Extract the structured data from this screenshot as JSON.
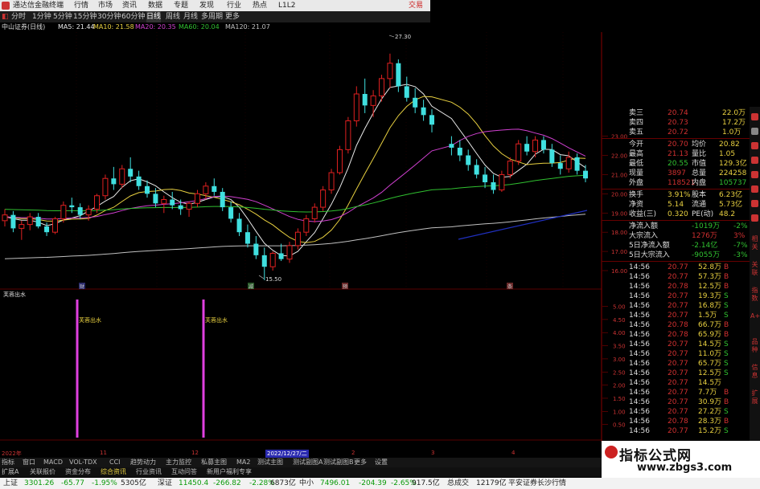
{
  "window": {
    "title": "通达信金融终端",
    "menus": [
      "行情",
      "市场",
      "资讯",
      "数据",
      "专题",
      "发现",
      "行业",
      "热点",
      "L1L2"
    ],
    "trade_label": "交易"
  },
  "period_tabs": [
    "分时",
    "1分钟",
    "5分钟",
    "15分钟",
    "30分钟",
    "60分钟",
    "日线",
    "周线",
    "月线",
    "多周期",
    "更多"
  ],
  "active_period": "日线",
  "indicators": {
    "stock": "中山证券(日线)",
    "ma5": "MA5: 21.44",
    "ma10": "MA10: 21.58",
    "ma20": "MA20: 20.35",
    "ma60": "MA60: 20.04",
    "ma120": "MA120: 21.07",
    "colors": {
      "ma5": "#e8e8e8",
      "ma10": "#e8d040",
      "ma20": "#d040d0",
      "ma60": "#30c030",
      "ma120": "#c0c0c0",
      "up": "#e02020",
      "down": "#40e0e0"
    }
  },
  "chart_annotations": {
    "high": "27.30",
    "low": "15.50"
  },
  "price_axis": [
    "23.00",
    "22.00",
    "21.00",
    "20.00",
    "19.00",
    "18.00",
    "17.00",
    "16.00"
  ],
  "sub_indicator": {
    "name": "芙蓉出水",
    "signal_label": "芙蓉出水",
    "axis": [
      "5.00",
      "4.50",
      "4.00",
      "3.50",
      "3.00",
      "2.50",
      "2.00",
      "1.50",
      "1.00",
      "0.50"
    ]
  },
  "event_markers": [
    "财",
    "减",
    "预",
    "条"
  ],
  "x_axis": {
    "start": "2022年",
    "m11": "11",
    "m12": "12",
    "cursor_date": "2022/12/27/二",
    "m2": "2",
    "m3": "3",
    "m4": "4"
  },
  "quote": {
    "order_book": [
      {
        "label": "卖三",
        "price": "20.74",
        "vol": "22.0万"
      },
      {
        "label": "卖四",
        "price": "20.73",
        "vol": "17.2万"
      },
      {
        "label": "卖五",
        "price": "20.72",
        "vol": "1.0万"
      }
    ],
    "stats": [
      {
        "l1": "今开",
        "v1": "20.70",
        "l2": "均价",
        "v2": "20.82"
      },
      {
        "l1": "最高",
        "v1": "21.13",
        "l2": "量比",
        "v2": "1.05"
      },
      {
        "l1": "最低",
        "v1": "20.55",
        "l2": "市值",
        "v2": "129.3亿"
      },
      {
        "l1": "现量",
        "v1": "3897",
        "l2": "总量",
        "v2": "224258"
      },
      {
        "l1": "外盘",
        "v1": "118521",
        "l2": "内盘",
        "v2": "105737"
      }
    ],
    "stats2": [
      {
        "l1": "换手",
        "v1": "3.91%",
        "l2": "股本",
        "v2": "6.23亿"
      },
      {
        "l1": "净资",
        "v1": "5.14",
        "l2": "流通",
        "v2": "5.73亿"
      },
      {
        "l1": "收益(三)",
        "v1": "0.320",
        "l2": "PE(动)",
        "v2": "48.2"
      }
    ],
    "flows": [
      {
        "label": "净流入额",
        "value": "-1019万",
        "pct": "-2%"
      },
      {
        "label": "大宗流入",
        "value": "1276万",
        "pct": "3%"
      },
      {
        "label": "5日净流入额",
        "value": "-2.14亿",
        "pct": "-7%"
      },
      {
        "label": "5日大宗流入",
        "value": "-9055万",
        "pct": "-3%"
      }
    ],
    "ticks": [
      {
        "t": "14:56",
        "p": "20.77",
        "v": "52.8万",
        "s": "B"
      },
      {
        "t": "14:56",
        "p": "20.77",
        "v": "57.3万",
        "s": "B"
      },
      {
        "t": "14:56",
        "p": "20.78",
        "v": "12.5万",
        "s": "B"
      },
      {
        "t": "14:56",
        "p": "20.77",
        "v": "19.3万",
        "s": "S"
      },
      {
        "t": "14:56",
        "p": "20.77",
        "v": "16.8万",
        "s": "S"
      },
      {
        "t": "14:56",
        "p": "20.77",
        "v": "1.5万",
        "s": "S"
      },
      {
        "t": "14:56",
        "p": "20.78",
        "v": "66.7万",
        "s": "B"
      },
      {
        "t": "14:56",
        "p": "20.78",
        "v": "65.9万",
        "s": "B"
      },
      {
        "t": "14:56",
        "p": "20.77",
        "v": "14.5万",
        "s": "S"
      },
      {
        "t": "14:56",
        "p": "20.77",
        "v": "11.0万",
        "s": "S"
      },
      {
        "t": "14:56",
        "p": "20.77",
        "v": "65.7万",
        "s": "S"
      },
      {
        "t": "14:56",
        "p": "20.77",
        "v": "12.5万",
        "s": "S"
      },
      {
        "t": "14:56",
        "p": "20.77",
        "v": "14.5万",
        "s": ""
      },
      {
        "t": "14:56",
        "p": "20.77",
        "v": "7.7万",
        "s": "B"
      },
      {
        "t": "14:56",
        "p": "20.77",
        "v": "30.9万",
        "s": "B"
      },
      {
        "t": "14:56",
        "p": "20.77",
        "v": "27.2万",
        "s": "S"
      },
      {
        "t": "14:56",
        "p": "20.78",
        "v": "28.3万",
        "s": "B"
      },
      {
        "t": "14:56",
        "p": "20.77",
        "v": "15.2万",
        "s": "S"
      }
    ]
  },
  "tabs_row1": [
    "指标",
    "窗口",
    "MACD",
    "VOL-TDX",
    "CCI",
    "趋势动力",
    "主力监控",
    "私募主图",
    "MA2",
    "测试主图",
    "测试副图A",
    "测试副图B",
    "更多",
    "设置"
  ],
  "tabs_row2": [
    "扩展A",
    "关联报价",
    "资金分布",
    "综合资讯",
    "行业资讯",
    "互动问答",
    "新用户福利专享"
  ],
  "status": {
    "sh_name": "上证",
    "sh_val": "3301.26",
    "sh_chg": "-65.77",
    "sh_pct": "-1.95%",
    "sh_amt": "5305亿",
    "sz_name": "深证",
    "sz_val": "11450.4",
    "sz_chg": "-266.82",
    "sz_pct": "-2.28%",
    "sz_amt": "6873亿",
    "zx_name": "中小",
    "zx_val": "7496.01",
    "zx_chg": "-204.39",
    "zx_pct": "-2.65%",
    "zx_amt": "917.5亿",
    "total_label": "总成交",
    "total_val": "12179亿",
    "broker": "平安证券长沙行情"
  },
  "watermark": {
    "line1": "指标公式网",
    "line2": "www.zbgs3.com"
  },
  "sidebar_text": [
    "相关",
    "关联",
    "指数",
    "A+H",
    "品种",
    "信息",
    "扩展"
  ],
  "chart_data": {
    "type": "candlestick",
    "ohlc": [
      [
        18.6,
        19.2,
        18.3,
        18.9
      ],
      [
        18.9,
        19.1,
        18.0,
        18.2
      ],
      [
        18.2,
        18.6,
        17.6,
        18.4
      ],
      [
        18.4,
        19.0,
        18.1,
        18.8
      ],
      [
        18.8,
        19.0,
        18.2,
        18.3
      ],
      [
        18.3,
        18.5,
        17.8,
        18.0
      ],
      [
        18.0,
        18.8,
        17.9,
        18.7
      ],
      [
        18.7,
        19.6,
        18.5,
        19.4
      ],
      [
        19.4,
        19.8,
        19.0,
        19.3
      ],
      [
        19.3,
        19.5,
        18.7,
        18.9
      ],
      [
        18.9,
        19.4,
        18.6,
        19.2
      ],
      [
        19.2,
        20.0,
        19.0,
        19.9
      ],
      [
        19.9,
        21.0,
        19.7,
        20.8
      ],
      [
        20.8,
        21.4,
        20.2,
        20.5
      ],
      [
        20.5,
        21.5,
        20.3,
        21.3
      ],
      [
        21.3,
        21.9,
        20.6,
        20.9
      ],
      [
        20.9,
        21.2,
        20.2,
        20.4
      ],
      [
        20.4,
        20.7,
        19.8,
        20.0
      ],
      [
        20.0,
        20.3,
        19.3,
        19.5
      ],
      [
        19.5,
        19.9,
        19.0,
        19.7
      ],
      [
        19.7,
        20.1,
        19.2,
        19.4
      ],
      [
        19.4,
        19.7,
        18.9,
        19.2
      ],
      [
        19.2,
        19.6,
        18.8,
        19.5
      ],
      [
        19.5,
        20.2,
        19.3,
        20.0
      ],
      [
        20.0,
        20.6,
        19.7,
        20.4
      ],
      [
        20.4,
        20.8,
        19.9,
        20.1
      ],
      [
        20.1,
        20.3,
        19.1,
        19.3
      ],
      [
        19.3,
        19.6,
        18.5,
        18.7
      ],
      [
        18.7,
        19.0,
        17.8,
        18.0
      ],
      [
        18.0,
        18.4,
        17.2,
        17.4
      ],
      [
        17.4,
        17.8,
        16.6,
        16.8
      ],
      [
        16.8,
        17.2,
        15.5,
        16.2
      ],
      [
        16.2,
        17.0,
        16.0,
        16.9
      ],
      [
        16.9,
        17.4,
        16.5,
        16.6
      ],
      [
        16.6,
        17.5,
        16.4,
        17.3
      ],
      [
        17.3,
        18.2,
        17.1,
        18.0
      ],
      [
        18.0,
        18.9,
        17.8,
        18.7
      ],
      [
        18.7,
        19.5,
        18.5,
        19.3
      ],
      [
        19.3,
        20.4,
        19.1,
        20.2
      ],
      [
        20.2,
        21.3,
        20.0,
        21.1
      ],
      [
        21.1,
        22.5,
        21.0,
        22.3
      ],
      [
        22.3,
        24.0,
        22.1,
        23.8
      ],
      [
        23.8,
        25.6,
        23.5,
        25.2
      ],
      [
        25.2,
        26.0,
        24.2,
        24.6
      ],
      [
        24.6,
        25.4,
        24.0,
        25.1
      ],
      [
        25.1,
        26.2,
        24.8,
        26.0
      ],
      [
        26.0,
        27.3,
        25.5,
        26.8
      ],
      [
        26.8,
        27.0,
        25.3,
        25.6
      ],
      [
        25.6,
        26.1,
        24.8,
        25.0
      ],
      [
        25.0,
        25.5,
        24.2,
        24.5
      ],
      [
        24.5,
        24.9,
        23.8,
        24.1
      ],
      [
        24.1,
        24.4,
        23.2,
        23.6
      ],
      [
        22.6,
        23.0,
        22.0,
        22.4
      ],
      [
        22.4,
        22.8,
        21.7,
        22.0
      ],
      [
        22.0,
        22.3,
        21.2,
        21.5
      ],
      [
        21.5,
        21.8,
        20.8,
        21.0
      ],
      [
        21.0,
        21.4,
        20.3,
        20.6
      ],
      [
        20.6,
        21.0,
        20.0,
        20.2
      ],
      [
        20.2,
        21.2,
        20.1,
        21.0
      ],
      [
        21.0,
        21.9,
        20.8,
        21.7
      ],
      [
        21.7,
        22.8,
        21.5,
        22.6
      ],
      [
        22.6,
        23.0,
        22.0,
        22.2
      ],
      [
        22.2,
        23.0,
        21.9,
        22.8
      ],
      [
        22.8,
        23.0,
        22.1,
        22.3
      ],
      [
        22.3,
        22.6,
        21.4,
        21.6
      ],
      [
        21.6,
        22.0,
        21.0,
        21.3
      ],
      [
        21.3,
        22.2,
        21.1,
        21.9
      ],
      [
        21.9,
        22.1,
        21.0,
        21.2
      ],
      [
        21.2,
        21.5,
        20.6,
        20.8
      ]
    ],
    "gap_after_index": 51,
    "signal_bars_at_index": [
      12,
      31
    ],
    "y_range": [
      15.5,
      27.5
    ]
  }
}
